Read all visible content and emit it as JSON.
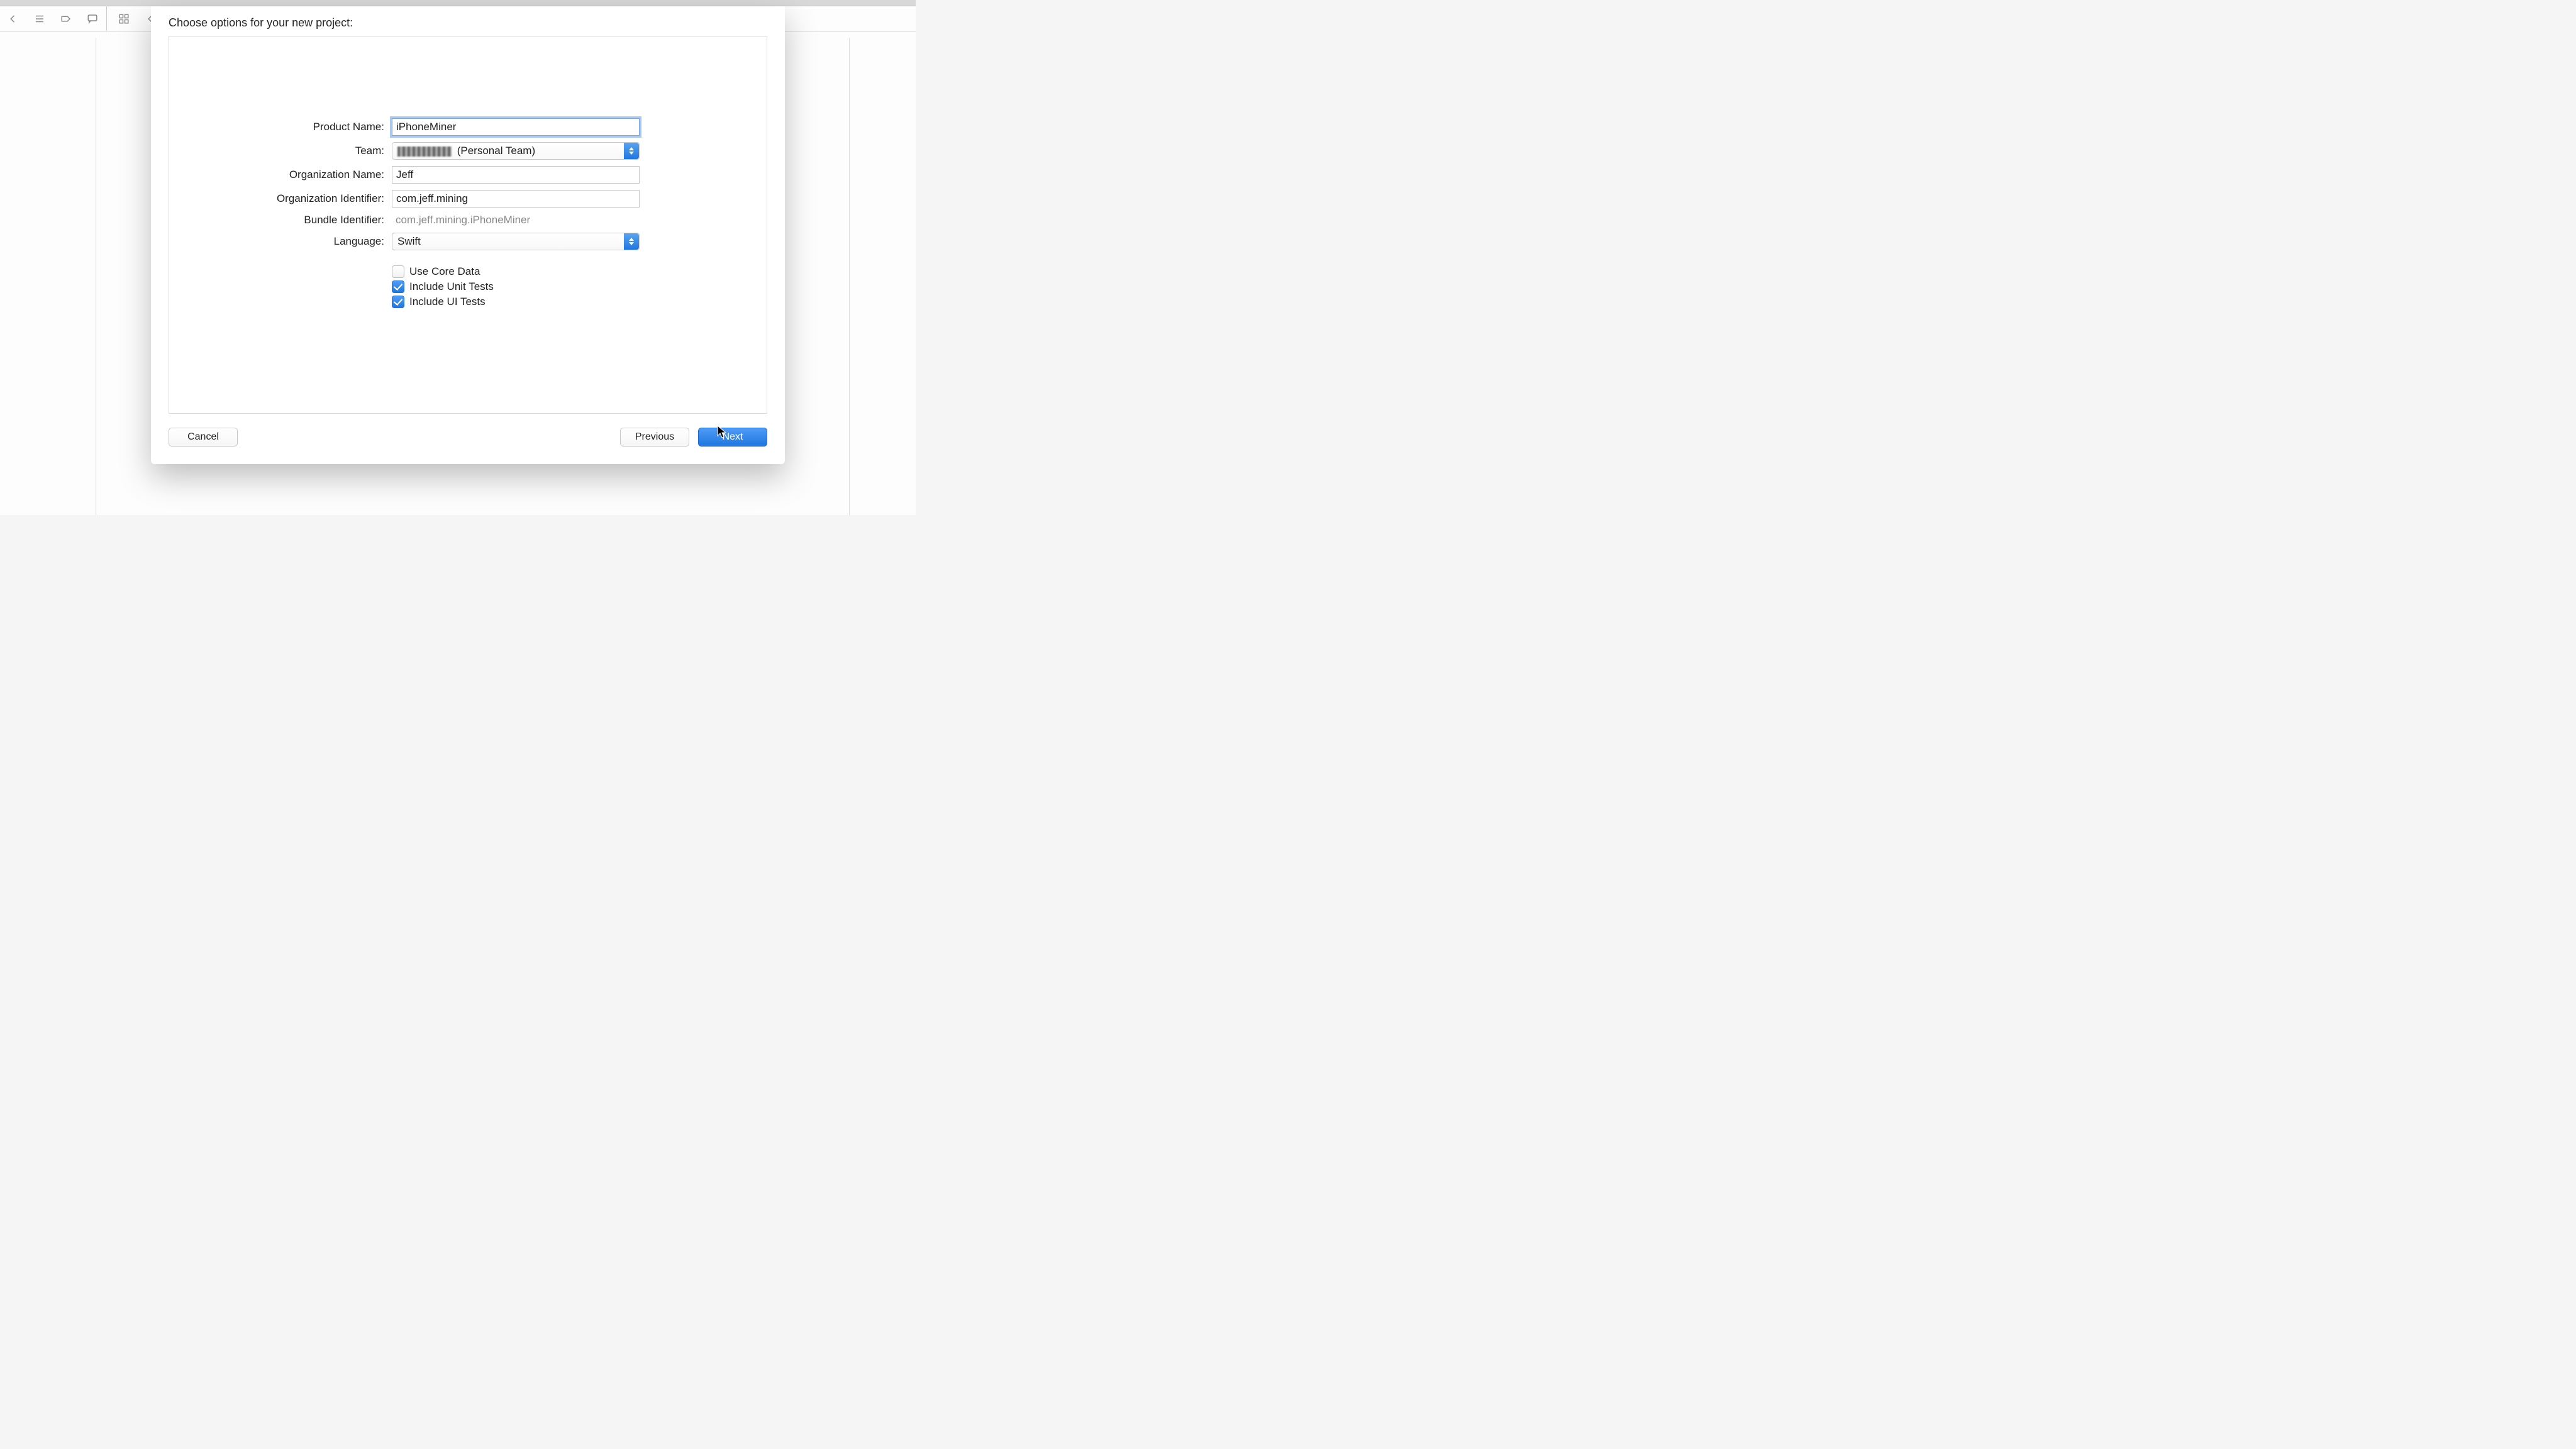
{
  "sheet": {
    "title": "Choose options for your new project:",
    "productName": {
      "label": "Product Name:",
      "value": "iPhoneMiner"
    },
    "team": {
      "label": "Team:",
      "suffix": " (Personal Team)"
    },
    "orgName": {
      "label": "Organization Name:",
      "value": "Jeff"
    },
    "orgId": {
      "label": "Organization Identifier:",
      "value": "com.jeff.mining"
    },
    "bundleId": {
      "label": "Bundle Identifier:",
      "value": "com.jeff.mining.iPhoneMiner"
    },
    "language": {
      "label": "Language:",
      "value": "Swift"
    },
    "coreData": {
      "label": "Use Core Data",
      "checked": false
    },
    "unitTests": {
      "label": "Include Unit Tests",
      "checked": true
    },
    "uiTests": {
      "label": "Include UI Tests",
      "checked": true
    }
  },
  "buttons": {
    "cancel": "Cancel",
    "previous": "Previous",
    "next": "Next"
  }
}
